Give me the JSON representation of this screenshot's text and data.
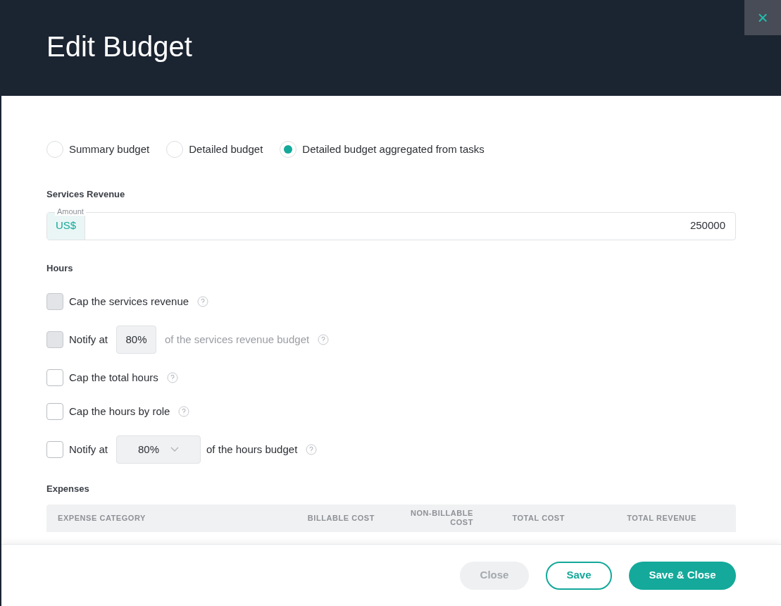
{
  "header": {
    "title": "Edit Budget",
    "close": "×"
  },
  "budget_types": [
    {
      "label": "Summary budget",
      "selected": false
    },
    {
      "label": "Detailed budget",
      "selected": false
    },
    {
      "label": "Detailed budget aggregated from tasks",
      "selected": true
    }
  ],
  "services_revenue": {
    "heading": "Services Revenue",
    "label": "Amount",
    "currency": "US$",
    "value": "250000"
  },
  "hours": {
    "heading": "Hours",
    "options": [
      {
        "kind": "check",
        "label": "Cap the services revenue",
        "checked": false,
        "disabled": true
      },
      {
        "kind": "notify_input",
        "label": "Notify at",
        "percent": "80%",
        "suffix": "of the services revenue budget",
        "checked": false,
        "disabled": true
      },
      {
        "kind": "check",
        "label": "Cap the total hours",
        "checked": false,
        "disabled": false
      },
      {
        "kind": "check",
        "label": "Cap the hours by role",
        "checked": false,
        "disabled": false
      },
      {
        "kind": "notify_select",
        "label": "Notify at",
        "percent": "80%",
        "suffix": "of the hours budget",
        "checked": false,
        "disabled": false
      }
    ]
  },
  "expenses": {
    "heading": "Expenses",
    "columns": [
      "EXPENSE CATEGORY",
      "BILLABLE COST",
      "NON-BILLABLE COST",
      "TOTAL COST",
      "TOTAL REVENUE"
    ]
  },
  "footer": {
    "buttons": [
      {
        "label": "Close",
        "kind": "disabled"
      },
      {
        "label": "Save",
        "kind": "outline"
      },
      {
        "label": "Save & Close",
        "kind": "primary"
      }
    ]
  }
}
